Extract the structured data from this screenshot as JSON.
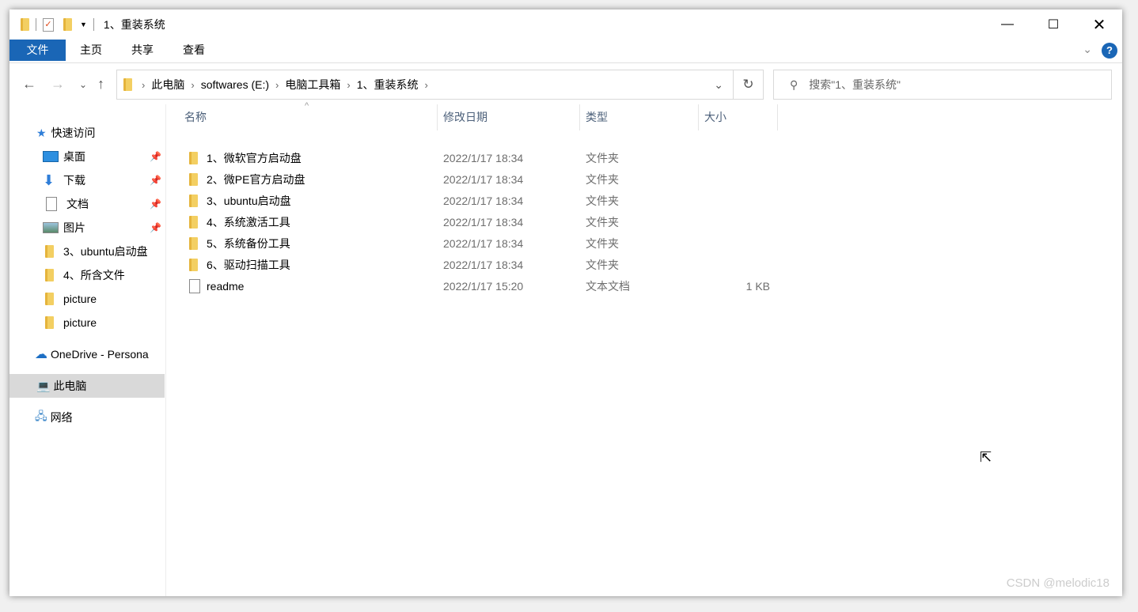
{
  "window": {
    "title": "1、重装系统"
  },
  "ribbon": {
    "tabs": [
      "文件",
      "主页",
      "共享",
      "查看"
    ]
  },
  "address": {
    "crumbs": [
      "此电脑",
      "softwares (E:)",
      "电脑工具箱",
      "1、重装系统"
    ],
    "search_placeholder": "搜索\"1、重装系统\""
  },
  "sidebar": {
    "quick_access": "快速访问",
    "items": [
      "桌面",
      "下载",
      "文档",
      "图片",
      "3、ubuntu启动盘",
      "4、所含文件",
      "picture",
      "picture"
    ],
    "onedrive": "OneDrive - Persona",
    "this_pc": "此电脑",
    "network": "网络"
  },
  "columns": [
    "名称",
    "修改日期",
    "类型",
    "大小"
  ],
  "files": [
    {
      "name": "1、微软官方启动盘",
      "date": "2022/1/17 18:34",
      "type": "文件夹",
      "size": ""
    },
    {
      "name": "2、微PE官方启动盘",
      "date": "2022/1/17 18:34",
      "type": "文件夹",
      "size": ""
    },
    {
      "name": "3、ubuntu启动盘",
      "date": "2022/1/17 18:34",
      "type": "文件夹",
      "size": ""
    },
    {
      "name": "4、系统激活工具",
      "date": "2022/1/17 18:34",
      "type": "文件夹",
      "size": ""
    },
    {
      "name": "5、系统备份工具",
      "date": "2022/1/17 18:34",
      "type": "文件夹",
      "size": ""
    },
    {
      "name": "6、驱动扫描工具",
      "date": "2022/1/17 18:34",
      "type": "文件夹",
      "size": ""
    },
    {
      "name": "readme",
      "date": "2022/1/17 15:20",
      "type": "文本文档",
      "size": "1 KB"
    }
  ],
  "watermark": "CSDN @melodic18"
}
